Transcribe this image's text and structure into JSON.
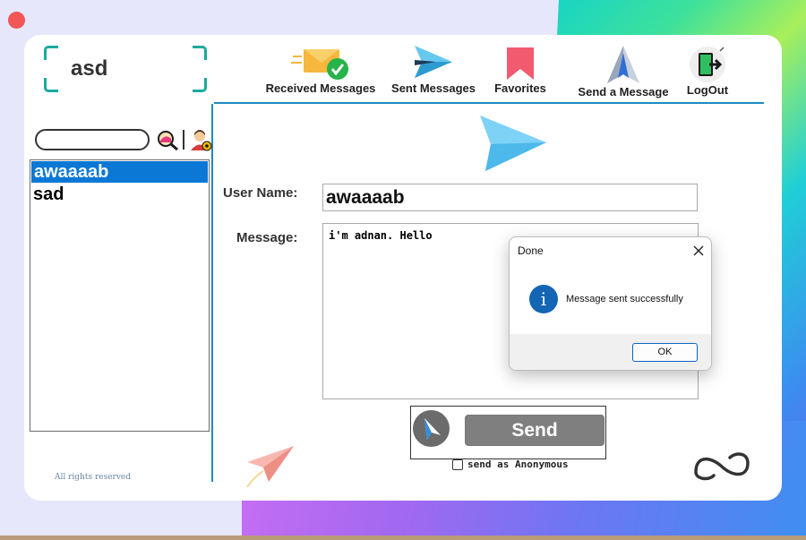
{
  "window": {
    "close_dot_color": "#f25656"
  },
  "header": {
    "username": "asd"
  },
  "nav": {
    "received": "Received Messages",
    "sent": "Sent Messages",
    "favorites": "Favorites",
    "send": "Send a Message",
    "logout": "LogOut"
  },
  "sidebar": {
    "search_value": "",
    "users": [
      {
        "label": "awaaaab",
        "selected": true
      },
      {
        "label": "sad",
        "selected": false
      }
    ],
    "footer": "All rights reserved"
  },
  "form": {
    "username_label": "User Name:",
    "username_value": "awaaaab",
    "message_label": "Message:",
    "message_value": "i'm adnan. Hello",
    "send_label": "Send",
    "anonymous_label": "send as Anonymous",
    "anonymous_checked": false
  },
  "dialog": {
    "title": "Done",
    "message": "Message sent successfully",
    "ok_label": "OK",
    "info_glyph": "i"
  },
  "colors": {
    "accent": "#1b8cc0",
    "selection": "#0a78d4",
    "frame": "#1aaa9d",
    "send_button": "#7f7f7f"
  }
}
